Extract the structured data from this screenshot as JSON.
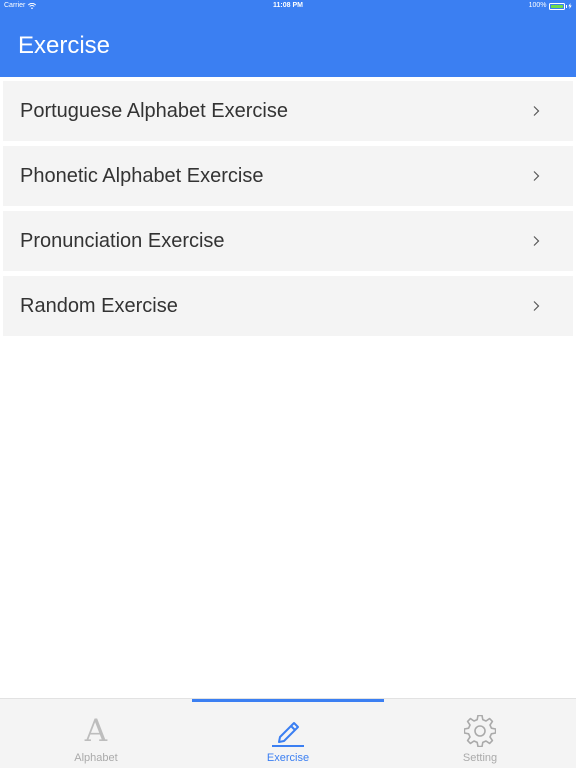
{
  "status_bar": {
    "carrier": "Carrier",
    "time": "11:08 PM",
    "battery": "100%",
    "battery_level": 1.0,
    "battery_color": "#6fdc4b"
  },
  "nav": {
    "title": "Exercise",
    "background": "#3b7ff2"
  },
  "list": {
    "items": [
      {
        "label": "Portuguese Alphabet Exercise",
        "icon": "chevron-right-icon"
      },
      {
        "label": "Phonetic Alphabet Exercise",
        "icon": "chevron-right-icon"
      },
      {
        "label": "Pronunciation Exercise",
        "icon": "chevron-right-icon"
      },
      {
        "label": "Random Exercise",
        "icon": "chevron-right-icon"
      }
    ]
  },
  "tabs": {
    "active": "Exercise",
    "accent_color": "#3b7ff2",
    "inactive_color": "#aaaaaa",
    "items": [
      {
        "label": "Alphabet",
        "icon": "letter-a-icon",
        "glyph": "A"
      },
      {
        "label": "Exercise",
        "icon": "pencil-icon"
      },
      {
        "label": "Setting",
        "icon": "gear-icon"
      }
    ]
  }
}
